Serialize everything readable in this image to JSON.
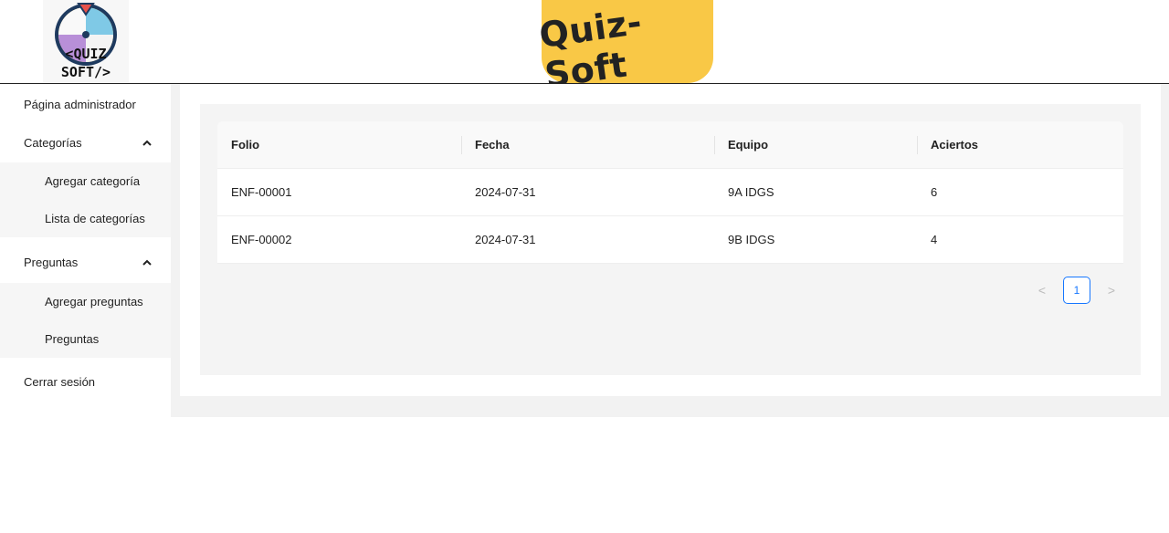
{
  "header": {
    "logo_top": "<QUIZ",
    "logo_bottom": "SOFT/>",
    "brand_title": "Quiz-Soft"
  },
  "sidebar": {
    "admin_page": "Página administrador",
    "categories": {
      "label": "Categorías",
      "chevron": "chevron-up-icon",
      "items": [
        {
          "label": "Agregar categoría"
        },
        {
          "label": "Lista de categorías"
        }
      ]
    },
    "questions": {
      "label": "Preguntas",
      "chevron": "chevron-up-icon",
      "items": [
        {
          "label": "Agregar preguntas"
        },
        {
          "label": "Preguntas"
        }
      ]
    },
    "logout": "Cerrar sesión"
  },
  "table": {
    "columns": [
      "Folio",
      "Fecha",
      "Equipo",
      "Aciertos"
    ],
    "rows": [
      [
        "ENF-00001",
        "2024-07-31",
        "9A IDGS",
        "6"
      ],
      [
        "ENF-00002",
        "2024-07-31",
        "9B IDGS",
        "4"
      ]
    ]
  },
  "pagination": {
    "prev": "<",
    "current": "1",
    "next": ">"
  },
  "colors": {
    "brand_yellow": "#f9c846",
    "accent_blue": "#1677ff"
  }
}
